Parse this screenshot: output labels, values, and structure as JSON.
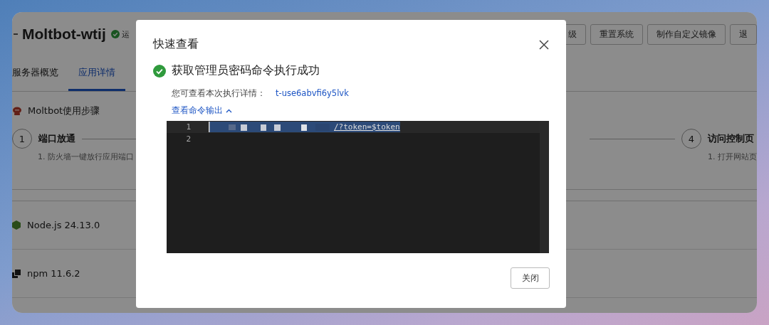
{
  "app": {
    "title": "Moltbot-wtij",
    "status_ok": true,
    "status": "运",
    "actions": [
      "级",
      "重置系统",
      "制作自定义镜像",
      "退"
    ],
    "tabs": [
      {
        "label": "服务器概览",
        "selected": false
      },
      {
        "label": "应用详情",
        "selected": true
      }
    ],
    "steps_title": "Moltbot使用步骤",
    "steps": [
      {
        "number": "1",
        "title": "端口放通",
        "desc": "1. 防火墙一键放行应用端口"
      },
      {
        "number": "4",
        "title": "访问控制页",
        "desc": "1. 打开网站页"
      }
    ],
    "packages": [
      {
        "kind": "node",
        "name": "Node.js 24.13.0"
      },
      {
        "kind": "npm",
        "name": "npm 11.6.2"
      }
    ]
  },
  "dialog": {
    "title": "快速查看",
    "result": "获取管理员密码命令执行成功",
    "detail_label": "您可查看本次执行详情：",
    "detail_link": "t-use6abvfi6y5lvk",
    "output_toggle": "查看命令输出",
    "expanded": true,
    "output_lines": [
      {
        "number": "1",
        "text": "/?token=$token",
        "redacted": true
      },
      {
        "number": "2",
        "redacted": false
      }
    ],
    "close_button": "关闭"
  }
}
